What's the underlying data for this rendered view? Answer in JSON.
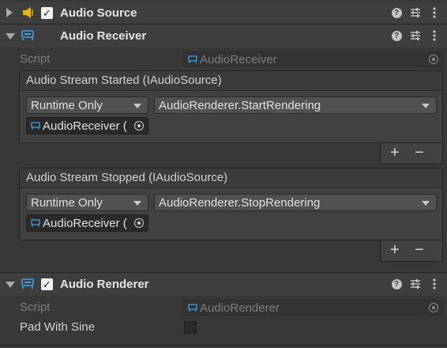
{
  "components": [
    {
      "title": "Audio Source",
      "expanded": false,
      "enabled": true,
      "icon": "speaker-icon",
      "icon_color": "#f0b400"
    },
    {
      "title": "Audio Receiver",
      "expanded": true,
      "icon": "script-icon",
      "icon_color": "#3ea3e8",
      "script": {
        "label": "Script",
        "value": "AudioReceiver"
      },
      "events": [
        {
          "title": "Audio Stream Started (IAudioSource)",
          "mode": "Runtime Only",
          "function": "AudioRenderer.StartRendering",
          "target": "AudioReceiver ("
        },
        {
          "title": "Audio Stream Stopped (IAudioSource)",
          "mode": "Runtime Only",
          "function": "AudioRenderer.StopRendering",
          "target": "AudioReceiver ("
        }
      ]
    },
    {
      "title": "Audio Renderer",
      "expanded": true,
      "enabled": true,
      "icon": "script-icon",
      "icon_color": "#3ea3e8",
      "script": {
        "label": "Script",
        "value": "AudioRenderer"
      },
      "properties": [
        {
          "label": "Pad With Sine",
          "type": "checkbox",
          "value": false
        }
      ]
    }
  ],
  "header_icons": [
    "help-icon",
    "presets-icon",
    "more-icon"
  ],
  "event_buttons": {
    "add": "+",
    "remove": "−"
  },
  "colors": {
    "background": "#383838",
    "header": "#3e3e3e",
    "field": "#2a2a2a",
    "text": "#d2d2d2",
    "script_icon": "#3ea3e8",
    "speaker_icon": "#f0b400"
  }
}
